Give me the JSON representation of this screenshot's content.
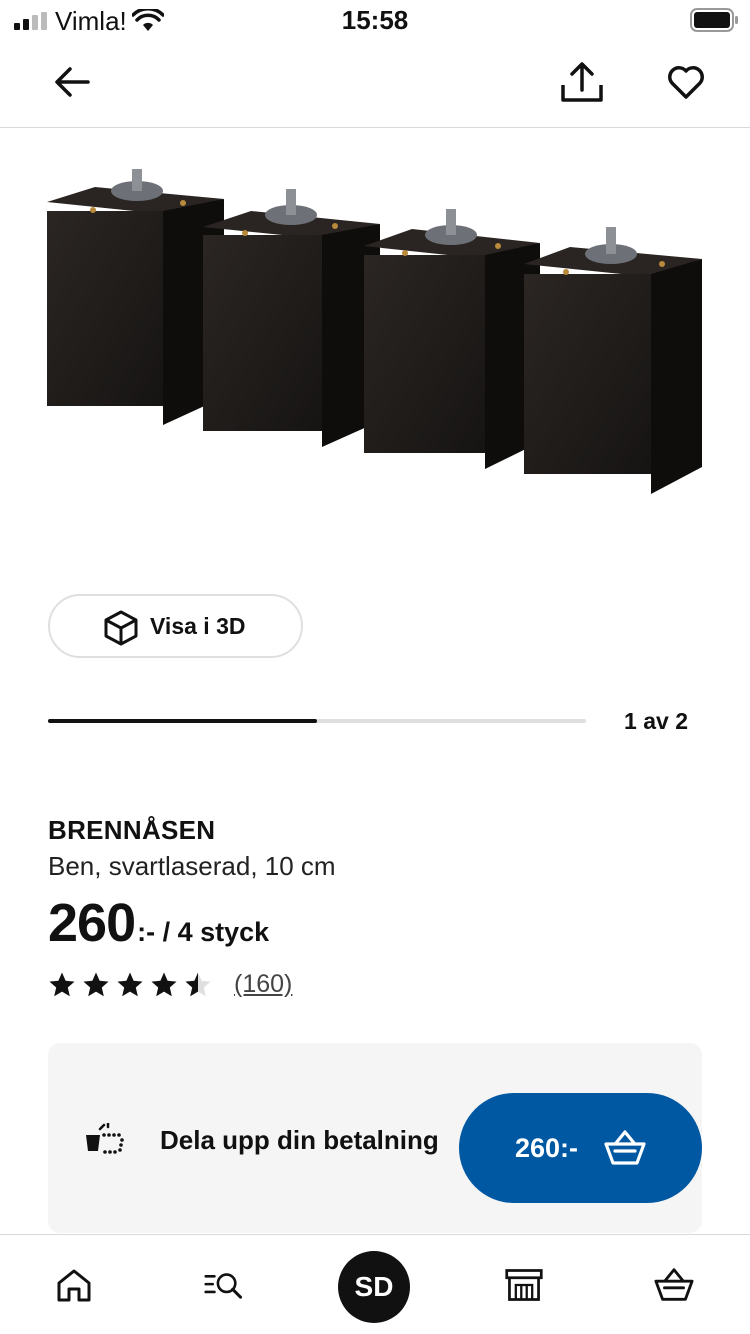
{
  "status_bar": {
    "carrier": "Vimla!",
    "time": "15:58"
  },
  "top_nav": {
    "back_icon": "arrow-left-icon",
    "share_icon": "share-icon",
    "favorite_icon": "heart-icon"
  },
  "gallery": {
    "view_3d_label": "Visa i 3D",
    "position_text": "1 av 2",
    "progress_fraction": 0.5
  },
  "product": {
    "name": "BRENNÅSEN",
    "description": "Ben, svartlaserad, 10 cm",
    "price": "260",
    "price_suffix": ":- / 4 styck",
    "rating_value": 4.5,
    "rating_max": 5,
    "review_count": "(160)"
  },
  "payment": {
    "text": "Dela upp din betalning"
  },
  "cart_button": {
    "price": "260:-"
  },
  "tab_bar": {
    "avatar_initials": "SD",
    "tabs": [
      "home-icon",
      "search-list-icon",
      "profile-avatar",
      "store-icon",
      "cart-icon"
    ]
  },
  "colors": {
    "accent": "#0058a3",
    "text": "#111111",
    "card_bg": "#f5f5f5",
    "divider": "#d9d9d9"
  }
}
